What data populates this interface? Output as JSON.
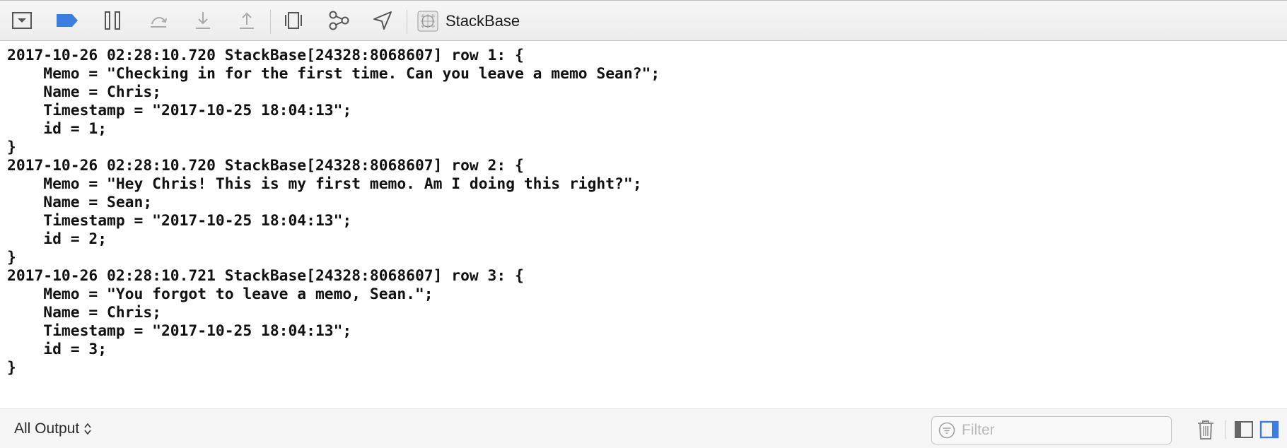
{
  "toolbar": {
    "buttons": [
      {
        "name": "hide-debug-area",
        "icon": "tray-down-icon"
      },
      {
        "name": "breakpoints-toggle",
        "icon": "breakpoint-icon",
        "color": "#3b7de0"
      },
      {
        "name": "pause",
        "icon": "pause-icon"
      },
      {
        "name": "step-over",
        "icon": "step-over-icon"
      },
      {
        "name": "step-into",
        "icon": "step-into-icon"
      },
      {
        "name": "step-out",
        "icon": "step-out-icon"
      },
      {
        "name": "debug-view-hierarchy",
        "icon": "view-hierarchy-icon"
      },
      {
        "name": "debug-memory-graph",
        "icon": "memory-graph-icon"
      },
      {
        "name": "simulate-location",
        "icon": "location-arrow-icon"
      }
    ],
    "scheme_name": "StackBase"
  },
  "console": {
    "lines": [
      "2017-10-26 02:28:10.720 StackBase[24328:8068607] row 1: {",
      "    Memo = \"Checking in for the first time. Can you leave a memo Sean?\";",
      "    Name = Chris;",
      "    Timestamp = \"2017-10-25 18:04:13\";",
      "    id = 1;",
      "}",
      "2017-10-26 02:28:10.720 StackBase[24328:8068607] row 2: {",
      "    Memo = \"Hey Chris! This is my first memo. Am I doing this right?\";",
      "    Name = Sean;",
      "    Timestamp = \"2017-10-25 18:04:13\";",
      "    id = 2;",
      "}",
      "2017-10-26 02:28:10.721 StackBase[24328:8068607] row 3: {",
      "    Memo = \"You forgot to leave a memo, Sean.\";",
      "    Name = Chris;",
      "    Timestamp = \"2017-10-25 18:04:13\";",
      "    id = 3;",
      "}"
    ]
  },
  "bottombar": {
    "output_selector": "All Output",
    "filter_placeholder": "Filter",
    "filter_value": "",
    "accent_color": "#3b7de0"
  }
}
